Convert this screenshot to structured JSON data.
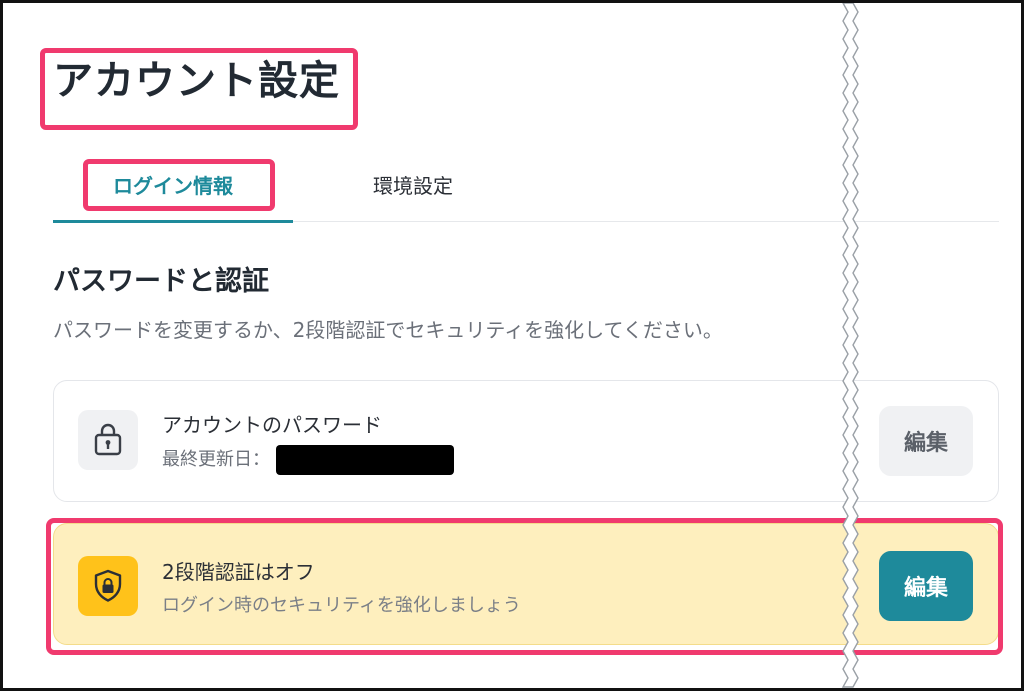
{
  "page": {
    "title": "アカウント設定"
  },
  "tabs": [
    {
      "label": "ログイン情報",
      "active": true
    },
    {
      "label": "環境設定",
      "active": false
    }
  ],
  "section": {
    "title": "パスワードと認証",
    "description": "パスワードを変更するか、2段階認証でセキュリティを強化してください。"
  },
  "password_card": {
    "icon": "lock-icon",
    "title": "アカウントのパスワード",
    "last_updated_label": "最終更新日：",
    "last_updated_value_redacted": true,
    "edit_label": "編集"
  },
  "twofa_card": {
    "icon": "shield-lock-icon",
    "title": "2段階認証はオフ",
    "subtitle": "ログイン時のセキュリティを強化しましょう",
    "edit_label": "編集"
  },
  "colors": {
    "accent": "#1e8a9b",
    "highlight": "#f03a6e",
    "warning_bg": "#feefbe",
    "warning_icon_bg": "#ffc21a"
  }
}
